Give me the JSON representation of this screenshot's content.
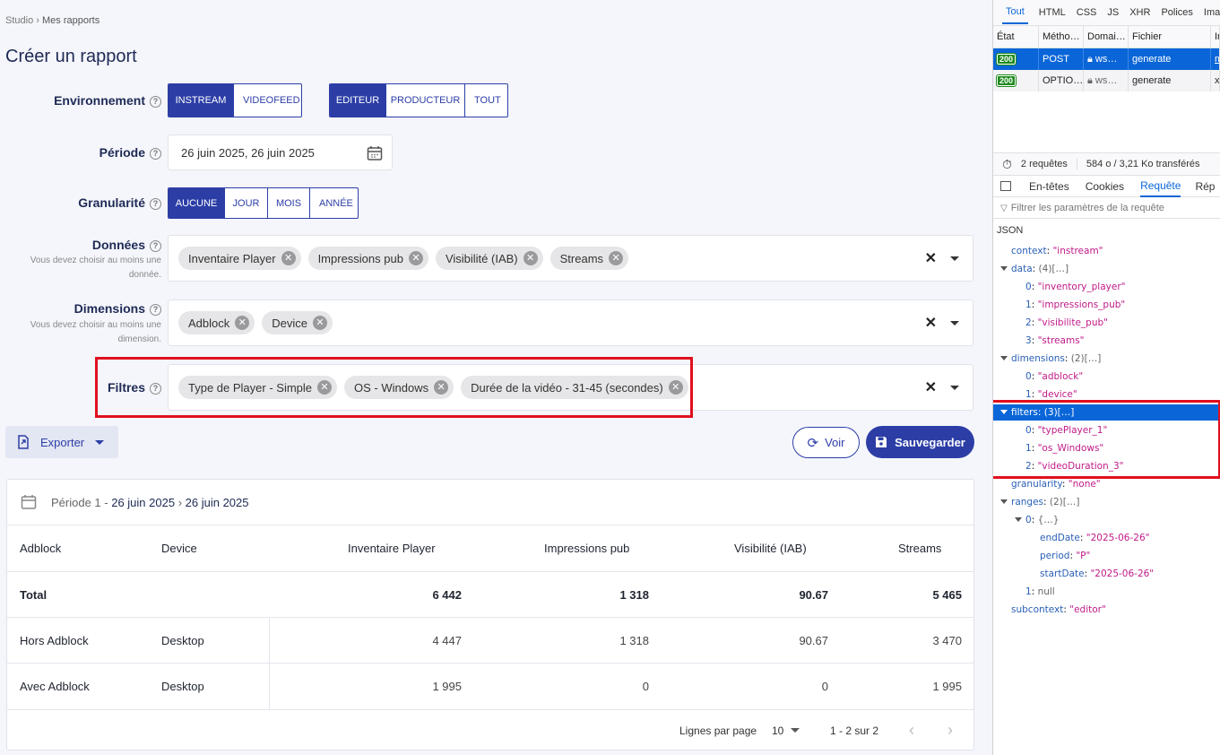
{
  "breadcrumb": {
    "root": "Studio",
    "sep": "›",
    "current": "Mes rapports"
  },
  "page_title": "Créer un rapport",
  "form": {
    "env_label": "Environnement",
    "env_options": [
      "INSTREAM",
      "VIDEOFEED"
    ],
    "role_options": [
      "EDITEUR",
      "PRODUCTEUR",
      "TOUT"
    ],
    "period_label": "Période",
    "period_value": "26 juin 2025, 26 juin 2025",
    "gran_label": "Granularité",
    "gran_options": [
      "AUCUNE",
      "JOUR",
      "MOIS",
      "ANNÉE"
    ],
    "data_label": "Données",
    "data_hint": "Vous devez choisir au moins une donnée.",
    "data_chips": [
      "Inventaire Player",
      "Impressions pub",
      "Visibilité (IAB)",
      "Streams"
    ],
    "dim_label": "Dimensions",
    "dim_hint": "Vous devez choisir au moins une dimension.",
    "dim_chips": [
      "Adblock",
      "Device"
    ],
    "filters_label": "Filtres",
    "filter_chips": [
      "Type de Player - Simple",
      "OS - Windows",
      "Durée de la vidéo - 31-45 (secondes)"
    ],
    "clear": "✕"
  },
  "actions": {
    "export": "Exporter",
    "view": "Voir",
    "save": "Sauvegarder"
  },
  "table": {
    "period_prefix": "Période 1 - ",
    "period_start": "26 juin 2025",
    "period_arrow": "›",
    "period_end": "26 juin 2025",
    "headers": [
      "Adblock",
      "Device",
      "Inventaire Player",
      "Impressions pub",
      "Visibilité (IAB)",
      "Streams"
    ],
    "rows": [
      [
        "Total",
        "",
        "6 442",
        "1 318",
        "90.67",
        "5 465"
      ],
      [
        "Hors Adblock",
        "Desktop",
        "4 447",
        "1 318",
        "90.67",
        "3 470"
      ],
      [
        "Avec Adblock",
        "Desktop",
        "1 995",
        "0",
        "0",
        "1 995"
      ]
    ],
    "rows_per_page_label": "Lignes par page",
    "rows_per_page": "10",
    "range": "1 - 2 sur 2"
  },
  "devtools": {
    "tabs": [
      "Tout",
      "HTML",
      "CSS",
      "JS",
      "XHR",
      "Polices",
      "Imag"
    ],
    "columns": [
      "État",
      "Métho…",
      "Domai…",
      "Fichier",
      "In"
    ],
    "requests": [
      {
        "status": "200",
        "method": "POST",
        "domain": "ws…",
        "file": "generate",
        "init": "m"
      },
      {
        "status": "200",
        "method": "OPTIO…",
        "domain": "ws…",
        "file": "generate",
        "init": "xh"
      }
    ],
    "summary_count": "2 requêtes",
    "summary_size": "584 o / 3,21 Ko transférés",
    "detail_tabs": [
      "En-têtes",
      "Cookies",
      "Requête",
      "Rép"
    ],
    "filter_placeholder": "Filtrer les paramètres de la requête",
    "json_label": "JSON",
    "json_lines": [
      {
        "k": "context",
        "v": "\"instream\""
      },
      {
        "k": "data",
        "v": "(4)[…]",
        "open": true
      },
      {
        "k": "0",
        "v": "\"inventory_player\"",
        "ind": 1
      },
      {
        "k": "1",
        "v": "\"impressions_pub\"",
        "ind": 1
      },
      {
        "k": "2",
        "v": "\"visibilite_pub\"",
        "ind": 1
      },
      {
        "k": "3",
        "v": "\"streams\"",
        "ind": 1
      },
      {
        "k": "dimensions",
        "v": "(2)[…]",
        "open": true
      },
      {
        "k": "0",
        "v": "\"adblock\"",
        "ind": 1
      },
      {
        "k": "1",
        "v": "\"device\"",
        "ind": 1
      },
      {
        "k": "filters",
        "v": "(3)[…]",
        "open": true,
        "sel": true
      },
      {
        "k": "0",
        "v": "\"typePlayer_1\"",
        "ind": 1
      },
      {
        "k": "1",
        "v": "\"os_Windows\"",
        "ind": 1
      },
      {
        "k": "2",
        "v": "\"videoDuration_3\"",
        "ind": 1
      },
      {
        "k": "granularity",
        "v": "\"none\""
      },
      {
        "k": "ranges",
        "v": "(2)[…]",
        "open": true
      },
      {
        "k": "0",
        "v": "{…}",
        "ind": 1,
        "open": true
      },
      {
        "k": "endDate",
        "v": "\"2025-06-26\"",
        "ind": 2
      },
      {
        "k": "period",
        "v": "\"P\"",
        "ind": 2
      },
      {
        "k": "startDate",
        "v": "\"2025-06-26\"",
        "ind": 2
      },
      {
        "k": "1",
        "v": "null",
        "ind": 1
      },
      {
        "k": "subcontext",
        "v": "\"editor\""
      }
    ]
  }
}
